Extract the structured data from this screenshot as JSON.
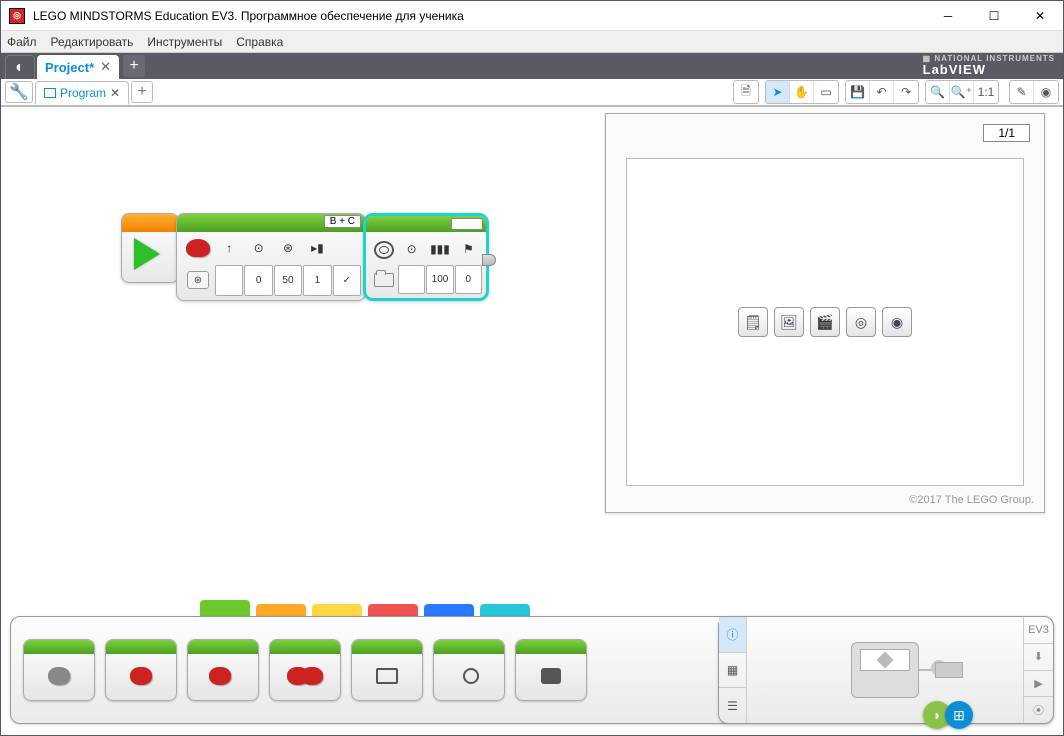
{
  "window": {
    "title": "LEGO MINDSTORMS Education EV3. Программное обеспечение для ученика"
  },
  "menu": {
    "file": "Файл",
    "edit": "Редактировать",
    "tools": "Инструменты",
    "help": "Справка"
  },
  "brand": "LabVIEW",
  "project_tab": {
    "label": "Project*"
  },
  "program_tab": {
    "label": "Program"
  },
  "toolbar_labels": {
    "ratio": "1:1"
  },
  "blocks": {
    "move": {
      "ports": "B + C",
      "params_top": [
        "↑",
        "⊙",
        "⊛",
        "▸▮",
        ""
      ],
      "params_bot": [
        "",
        "0",
        "50",
        "1",
        "✓"
      ]
    },
    "sound": {
      "params_top": [
        "⊙",
        "▮▮▮",
        "⚑"
      ],
      "params_bot": [
        "",
        "100",
        "0"
      ]
    }
  },
  "content_editor": {
    "page_indicator": "1/1",
    "copyright": "©2017 The LEGO Group."
  },
  "palette_colors": [
    "#6bc92e",
    "#ffa726",
    "#ffd740",
    "#ef5350",
    "#2979ff",
    "#26c6da"
  ],
  "hw_panel": {
    "ev3": "EV3"
  }
}
